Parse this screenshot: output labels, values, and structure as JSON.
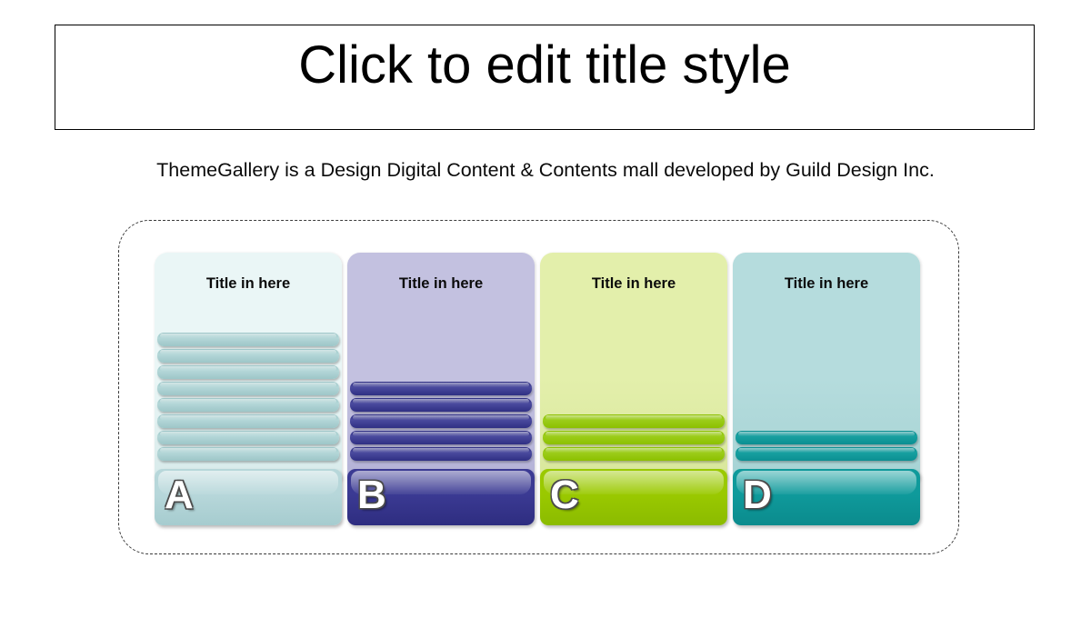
{
  "slide": {
    "title": "Click to edit title style",
    "subtitle": "ThemeGallery  is a Design Digital Content & Contents mall developed by Guild Design Inc."
  },
  "diagram": {
    "frame_style": "dashed-rounded",
    "columns": [
      {
        "letter": "A",
        "title": "Title in here",
        "bar_count": 8,
        "panel_color": "#eaf6f6",
        "panel_color_bottom": "#d7eaea",
        "bar_color": "#b4d7d8",
        "bar_color_dark": "#9dc6c8",
        "base_color": "#b7d7da",
        "base_color_dark": "#a6cccf"
      },
      {
        "letter": "B",
        "title": "Title in here",
        "bar_count": 5,
        "panel_color": "#c3c1e0",
        "panel_color_bottom": "#b4b2d7",
        "bar_color": "#4a4a9e",
        "bar_color_dark": "#2f2f83",
        "base_color": "#3b3a93",
        "base_color_dark": "#2e2d80"
      },
      {
        "letter": "C",
        "title": "Title in here",
        "bar_count": 3,
        "panel_color": "#e3efab",
        "panel_color_bottom": "#d8e79c",
        "bar_color": "#9ccd1a",
        "bar_color_dark": "#8cc000",
        "base_color": "#9ac900",
        "base_color_dark": "#8bbb00"
      },
      {
        "letter": "D",
        "title": "Title in here",
        "bar_count": 2,
        "panel_color": "#b5dcdd",
        "panel_color_bottom": "#a6d3d4",
        "bar_color": "#17a0a0",
        "bar_color_dark": "#0b8f92",
        "base_color": "#0f9a9b",
        "base_color_dark": "#0b8b8d"
      }
    ]
  }
}
